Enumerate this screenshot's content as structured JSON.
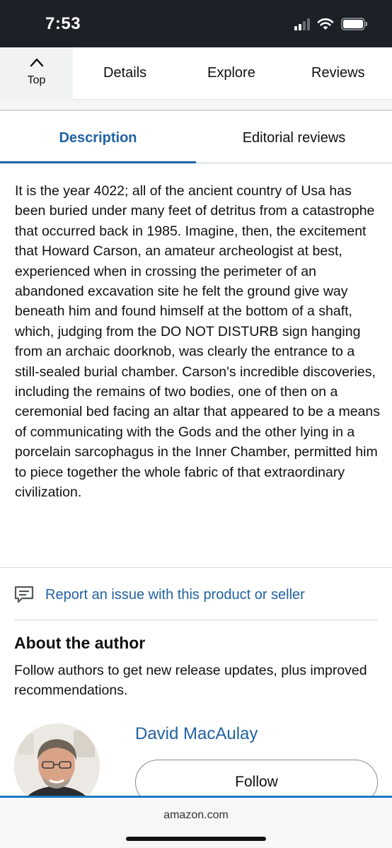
{
  "status_bar": {
    "time": "7:53",
    "icons": [
      "cellular-signal-icon",
      "wifi-icon",
      "battery-icon"
    ]
  },
  "top_nav": {
    "top_label": "Top",
    "links": [
      "Details",
      "Explore",
      "Reviews"
    ]
  },
  "tabs": {
    "active": "Description",
    "inactive": "Editorial reviews"
  },
  "description": {
    "text": "It is the year 4022; all of the ancient country of Usa has been buried under many feet of detritus from a catastrophe that occurred back in 1985. Imagine, then, the excitement that Howard Carson, an amateur archeologist at best, experienced when in crossing the perimeter of an abandoned excavation site he felt the ground give way beneath him and found himself at the bottom of a shaft, which, judging from the DO NOT DISTURB sign hanging from an archaic doorknob, was clearly the entrance to a still-sealed burial chamber. Carson's incredible discoveries, including the remains of two bodies, one of then on a ceremonial bed facing an altar that appeared to be a means of communicating with the Gods and the other lying in a porcelain sarcophagus in the Inner Chamber, permitted him to piece together the whole fabric of that extraordinary civilization."
  },
  "report": {
    "label": "Report an issue with this product or seller",
    "icon": "feedback-icon"
  },
  "about": {
    "title": "About the author",
    "subtitle": "Follow authors to get new release updates, plus improved recommendations.",
    "author_name": "David MacAulay",
    "follow_label": "Follow"
  },
  "browser": {
    "url": "amazon.com"
  },
  "colors": {
    "link_blue": "#2162a1",
    "status_bar_bg": "#1c2127",
    "bottom_accent": "#1a78c2"
  }
}
